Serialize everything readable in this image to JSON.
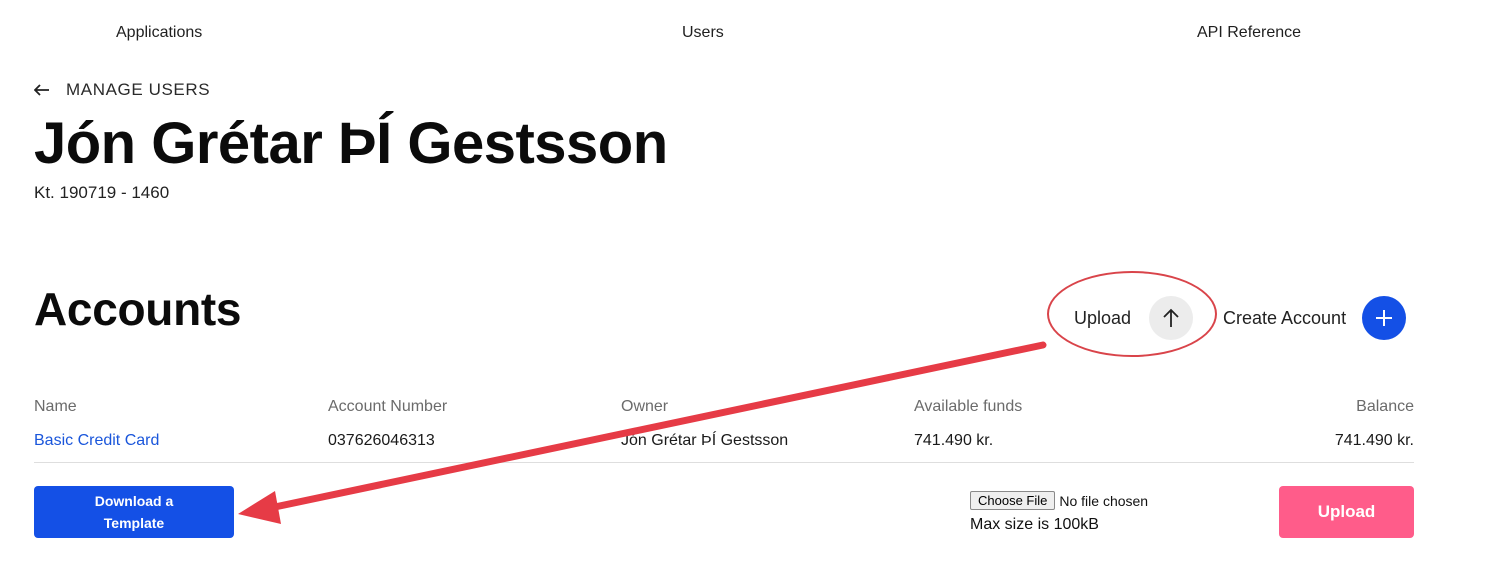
{
  "nav": {
    "items": [
      {
        "label": "Applications"
      },
      {
        "label": "Users"
      },
      {
        "label": "API Reference"
      }
    ]
  },
  "breadcrumb": {
    "back_icon": "arrow-left-icon",
    "label": "MANAGE USERS"
  },
  "user": {
    "name": "Jón Grétar ÞÍ Gestsson",
    "id_text": "Kt. 190719 - 1460"
  },
  "accounts": {
    "title": "Accounts",
    "upload_label": "Upload",
    "upload_icon": "arrow-up-icon",
    "create_label": "Create Account",
    "create_icon": "plus-icon",
    "table": {
      "headers": [
        "Name",
        "Account Number",
        "Owner",
        "Available funds",
        "Balance"
      ],
      "rows": [
        [
          "Basic Credit Card",
          "037626046313",
          "Jón Grétar ÞÍ Gestsson",
          "741.490 kr.",
          "741.490 kr."
        ]
      ]
    }
  },
  "template": {
    "download_line1": "Download a",
    "download_line2": "Template"
  },
  "file_upload": {
    "choose_label": "Choose File",
    "status": "No file chosen",
    "max_size": "Max size is 100kB",
    "upload_button": "Upload"
  },
  "colors": {
    "primary": "#1450e6",
    "upload_button": "#ff5c8a",
    "link": "#1a56db",
    "annotation": "#e63b46"
  }
}
